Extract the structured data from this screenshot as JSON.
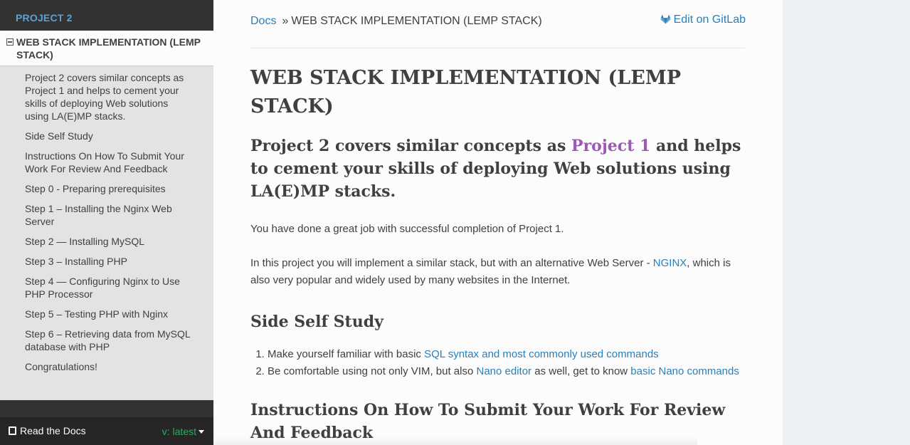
{
  "sidebar": {
    "caption": "PROJECT 2",
    "current_page": "WEB STACK IMPLEMENTATION (LEMP STACK)",
    "items": [
      {
        "label": "Project 2 covers similar concepts as Project 1 and helps to cement your skills of deploying Web solutions using LA(E)MP stacks."
      },
      {
        "label": "Side Self Study"
      },
      {
        "label": "Instructions On How To Submit Your Work For Review And Feedback"
      },
      {
        "label": "Step 0 - Preparing prerequisites"
      },
      {
        "label": "Step 1 – Installing the Nginx Web Server"
      },
      {
        "label": "Step 2 — Installing MySQL"
      },
      {
        "label": "Step 3 – Installing PHP"
      },
      {
        "label": "Step 4 — Configuring Nginx to Use PHP Processor"
      },
      {
        "label": "Step 5 – Testing PHP with Nginx"
      },
      {
        "label": "Step 6 – Retrieving data from MySQL database with PHP"
      },
      {
        "label": "Congratulations!"
      }
    ]
  },
  "rtd": {
    "label": "Read the Docs",
    "version": "v: latest"
  },
  "breadcrumbs": {
    "docs": "Docs",
    "separator": "»",
    "current": "WEB STACK IMPLEMENTATION (LEMP STACK)",
    "edit": "Edit on GitLab"
  },
  "article": {
    "title": "WEB STACK IMPLEMENTATION (LEMP STACK)",
    "intro_heading": {
      "before": "Project 2 covers similar concepts as ",
      "link": "Project 1",
      "after": " and helps to cement your skills of deploying Web solutions using LA(E)MP stacks."
    },
    "para1": "You have done a great job with successful completion of Project 1.",
    "para2": {
      "before": "In this project you will implement a similar stack, but with an alternative Web Server - ",
      "link": "NGINX",
      "after": ", which is also very popular and widely used by many websites in the Internet."
    },
    "side_heading": "Side Self Study",
    "list": {
      "item1_before": "Make yourself familiar with basic ",
      "item1_link": "SQL syntax and most commonly used commands",
      "item2_before": "Be comfortable using not only VIM, but also ",
      "item2_link1": "Nano editor",
      "item2_mid": " as well, get to know ",
      "item2_link2": "basic Nano commands"
    },
    "instr_heading": "Instructions On How To Submit Your Work For Review And Feedback"
  },
  "colors": {
    "sidebar_bg": "#343131",
    "caption": "#55a5d9",
    "link": "#2980b9",
    "visited_link": "#9b59b6",
    "version": "#27ae60"
  }
}
